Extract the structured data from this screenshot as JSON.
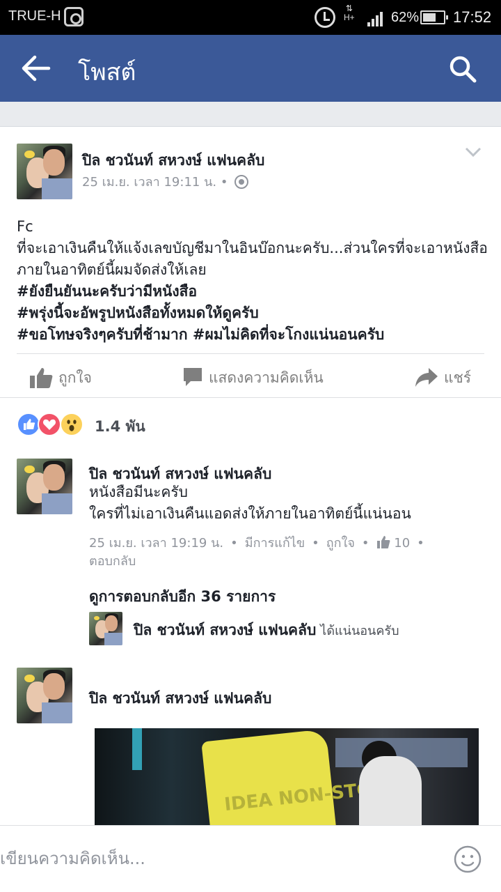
{
  "status_bar": {
    "carrier": "TRUE-H",
    "network": "H+",
    "battery": "62%",
    "time": "17:52"
  },
  "app_bar": {
    "title": "โพสต์",
    "back_icon": "arrow-left-icon",
    "search_icon": "search-icon"
  },
  "post": {
    "author": "ปิล ชวนันท์ สหวงษ์ แฟนคลับ",
    "meta": "25 เม.ย. เวลา 19:11 น. •",
    "lines": [
      "Fc",
      "ที่จะเอาเงินคืนให้แจ้งเลขบัญชีมาในอินบ๊อกนะครับ...ส่วนใครที่จะเอาหนังสือภายในอาทิตย์นี้ผมจัดส่งให้เลย"
    ],
    "hashtags": [
      "#ยังยืนยันนะครับว่ามีหนังสือ",
      "#พรุ่งนี้จะอัพรูปหนังสือทั้งหมดให้ดูครับ",
      "#ขอโทษจริงๆครับที่ช้ามาก #ผมไม่คิดที่จะโกงแน่นอนครับ"
    ],
    "actions": {
      "like": "ถูกใจ",
      "comment": "แสดงความคิดเห็น",
      "share": "แชร์"
    }
  },
  "reactions": {
    "count": "1.4 พัน"
  },
  "comments": [
    {
      "author": "ปิล ชวนันท์ สหวงษ์ แฟนคลับ",
      "lines": [
        "หนังสือมีนะครับ",
        "ใครที่ไม่เอาเงินคืนแอดส่งให้ภายในอาทิตย์นี้แน่นอน"
      ],
      "time": "25 เม.ย. เวลา 19:19 น.",
      "edited": "มีการแก้ไข",
      "like": "ถูกใจ",
      "likes": "10",
      "reply": "ตอบกลับ",
      "more_replies": "ดูการตอบกลับอีก 36 รายการ",
      "reply_preview": {
        "author": "ปิล ชวนันท์ สหวงษ์ แฟนคลับ",
        "text": "ได้แน่นอนครับ"
      }
    },
    {
      "author": "ปิล ชวนันท์ สหวงษ์ แฟนคลับ",
      "photo_text": "IDEA NON-STO"
    }
  ],
  "composer": {
    "placeholder": "เขียนความคิดเห็น..."
  },
  "colors": {
    "brand": "#3b5998",
    "like_blue": "#5890ff",
    "love_red": "#f25268",
    "wow_yellow": "#fcd15b"
  }
}
